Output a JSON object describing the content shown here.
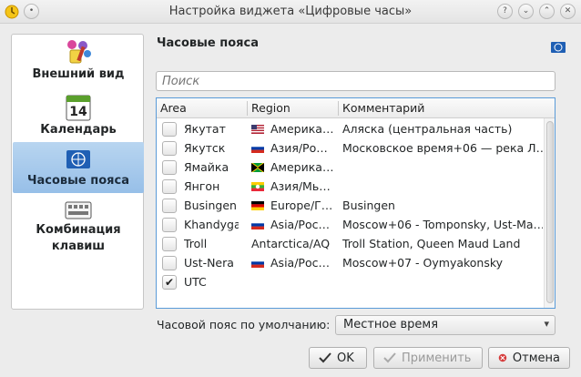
{
  "window": {
    "title": "Настройка виджета «Цифровые часы»"
  },
  "nav": [
    {
      "label": "Внешний вид",
      "icon": "appearance-icon"
    },
    {
      "label": "Календарь",
      "icon": "calendar-icon",
      "day": "14"
    },
    {
      "label": "Часовые пояса",
      "icon": "globe-flag-icon",
      "selected": true
    },
    {
      "label": "Комбинация клавиш",
      "icon": "keyboard-icon"
    }
  ],
  "section": {
    "title": "Часовые пояса"
  },
  "search": {
    "placeholder": "Поиск"
  },
  "table": {
    "headers": [
      "Area",
      "Region",
      "Комментарий"
    ],
    "rows": [
      {
        "area": "Якутат",
        "flag": "us",
        "region": "Америка…",
        "comment": "Аляска (центральная часть)",
        "checked": false
      },
      {
        "area": "Якутск",
        "flag": "ru",
        "region": "Азия/Ро…",
        "comment": "Московское время+06 — река Л…",
        "checked": false
      },
      {
        "area": "Ямайка",
        "flag": "jm",
        "region": "Америка…",
        "comment": "",
        "checked": false
      },
      {
        "area": "Янгон",
        "flag": "mm",
        "region": "Азия/Мь…",
        "comment": "",
        "checked": false
      },
      {
        "area": "Busingen",
        "flag": "de",
        "region": "Europe/Г…",
        "comment": "Busingen",
        "checked": false
      },
      {
        "area": "Khandyga",
        "flag": "ru",
        "region": "Asia/Рос…",
        "comment": "Moscow+06 - Tomponsky, Ust-Ma…",
        "checked": false
      },
      {
        "area": "Troll",
        "flag": "",
        "region": "Antarctica/AQ",
        "comment": "Troll Station, Queen Maud Land",
        "checked": false
      },
      {
        "area": "Ust-Nera",
        "flag": "ru",
        "region": "Asia/Рос…",
        "comment": "Moscow+07 - Oymyakonsky",
        "checked": false
      },
      {
        "area": "UTC",
        "flag": "",
        "region": "",
        "comment": "",
        "checked": true
      }
    ]
  },
  "default_tz": {
    "label": "Часовой пояс по умолчанию:",
    "value": "Местное время"
  },
  "buttons": {
    "ok": "OK",
    "apply": "Применить",
    "cancel": "Отмена"
  },
  "colors": {
    "selection": "#97bfe8",
    "focus_border": "#5a9bd8"
  }
}
